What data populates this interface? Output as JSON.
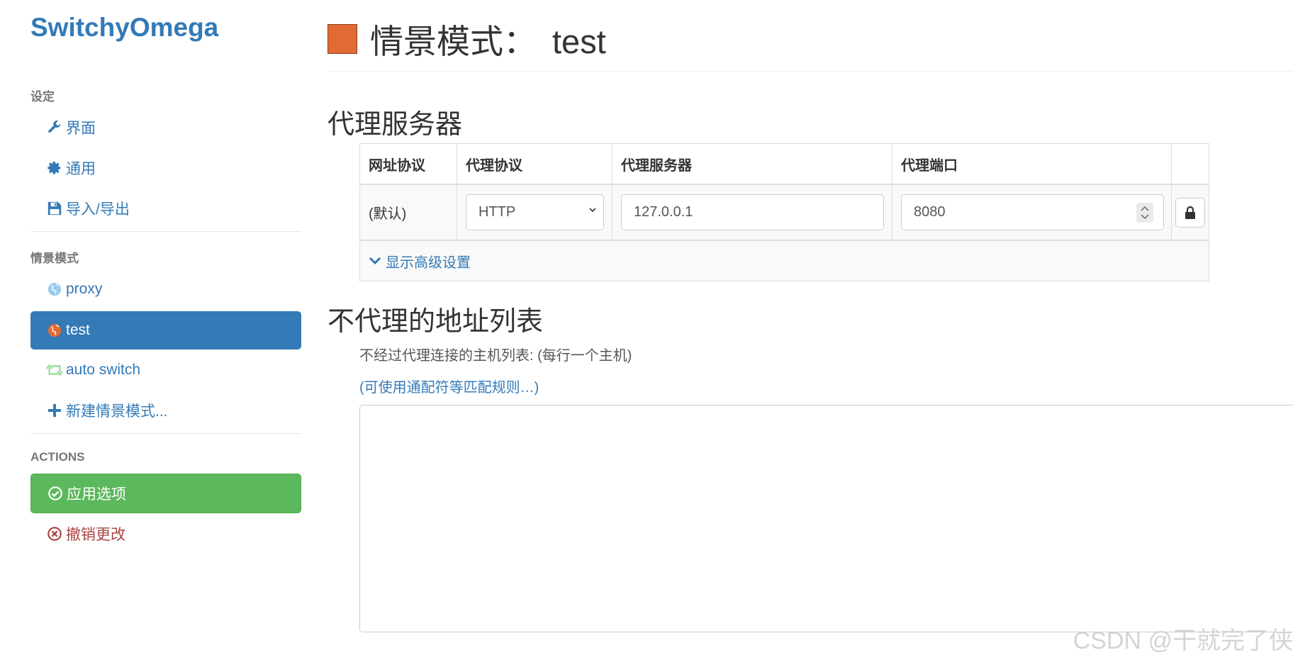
{
  "sidebar": {
    "brand": "SwitchyOmega",
    "settings_header": "设定",
    "settings_items": [
      {
        "label": "界面",
        "icon": "wrench-icon"
      },
      {
        "label": "通用",
        "icon": "gear-icon"
      },
      {
        "label": "导入/导出",
        "icon": "floppy-disk-icon"
      }
    ],
    "profiles_header": "情景模式",
    "profiles": [
      {
        "label": "proxy",
        "icon": "globe-icon",
        "color": "#99ccee"
      },
      {
        "label": "test",
        "icon": "globe-icon",
        "color": "#e26a33",
        "active": true
      },
      {
        "label": "auto switch",
        "icon": "retweet-icon",
        "color": "#99dd99"
      },
      {
        "label": "新建情景模式...",
        "icon": "plus-icon"
      }
    ],
    "actions_header": "ACTIONS",
    "apply_label": "应用选项",
    "discard_label": "撤销更改"
  },
  "profile": {
    "title_prefix": "情景模式：",
    "name": "test",
    "color": "#e26a33"
  },
  "proxy_section": {
    "title": "代理服务器",
    "headers": [
      "网址协议",
      "代理协议",
      "代理服务器",
      "代理端口"
    ],
    "row": {
      "scheme": "(默认)",
      "protocol": "HTTP",
      "server": "127.0.0.1",
      "port": "8080"
    },
    "advanced_label": "显示高级设置"
  },
  "bypass_section": {
    "title": "不代理的地址列表",
    "description": "不经过代理连接的主机列表: (每行一个主机)",
    "wildcard_link": "(可使用通配符等匹配规则…)",
    "textarea_value": ""
  },
  "watermark": "CSDN @干就完了侠",
  "colors": {
    "primary": "#337ab7",
    "success": "#5cb85c",
    "danger": "#a94442",
    "muted": "#777777"
  }
}
